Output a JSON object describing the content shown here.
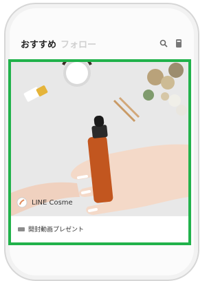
{
  "header": {
    "tabs": [
      {
        "label": "おすすめ",
        "active": true
      },
      {
        "label": "フォロー",
        "active": false
      }
    ],
    "icons": [
      "search-icon",
      "profile-icon"
    ]
  },
  "feed_card": {
    "highlight_color": "#21b24b",
    "creator_name": "LINE Cosme",
    "tag_label": "開封動画プレゼント",
    "image_subject": "hand holding amber dropper bottle with cosmetics"
  }
}
